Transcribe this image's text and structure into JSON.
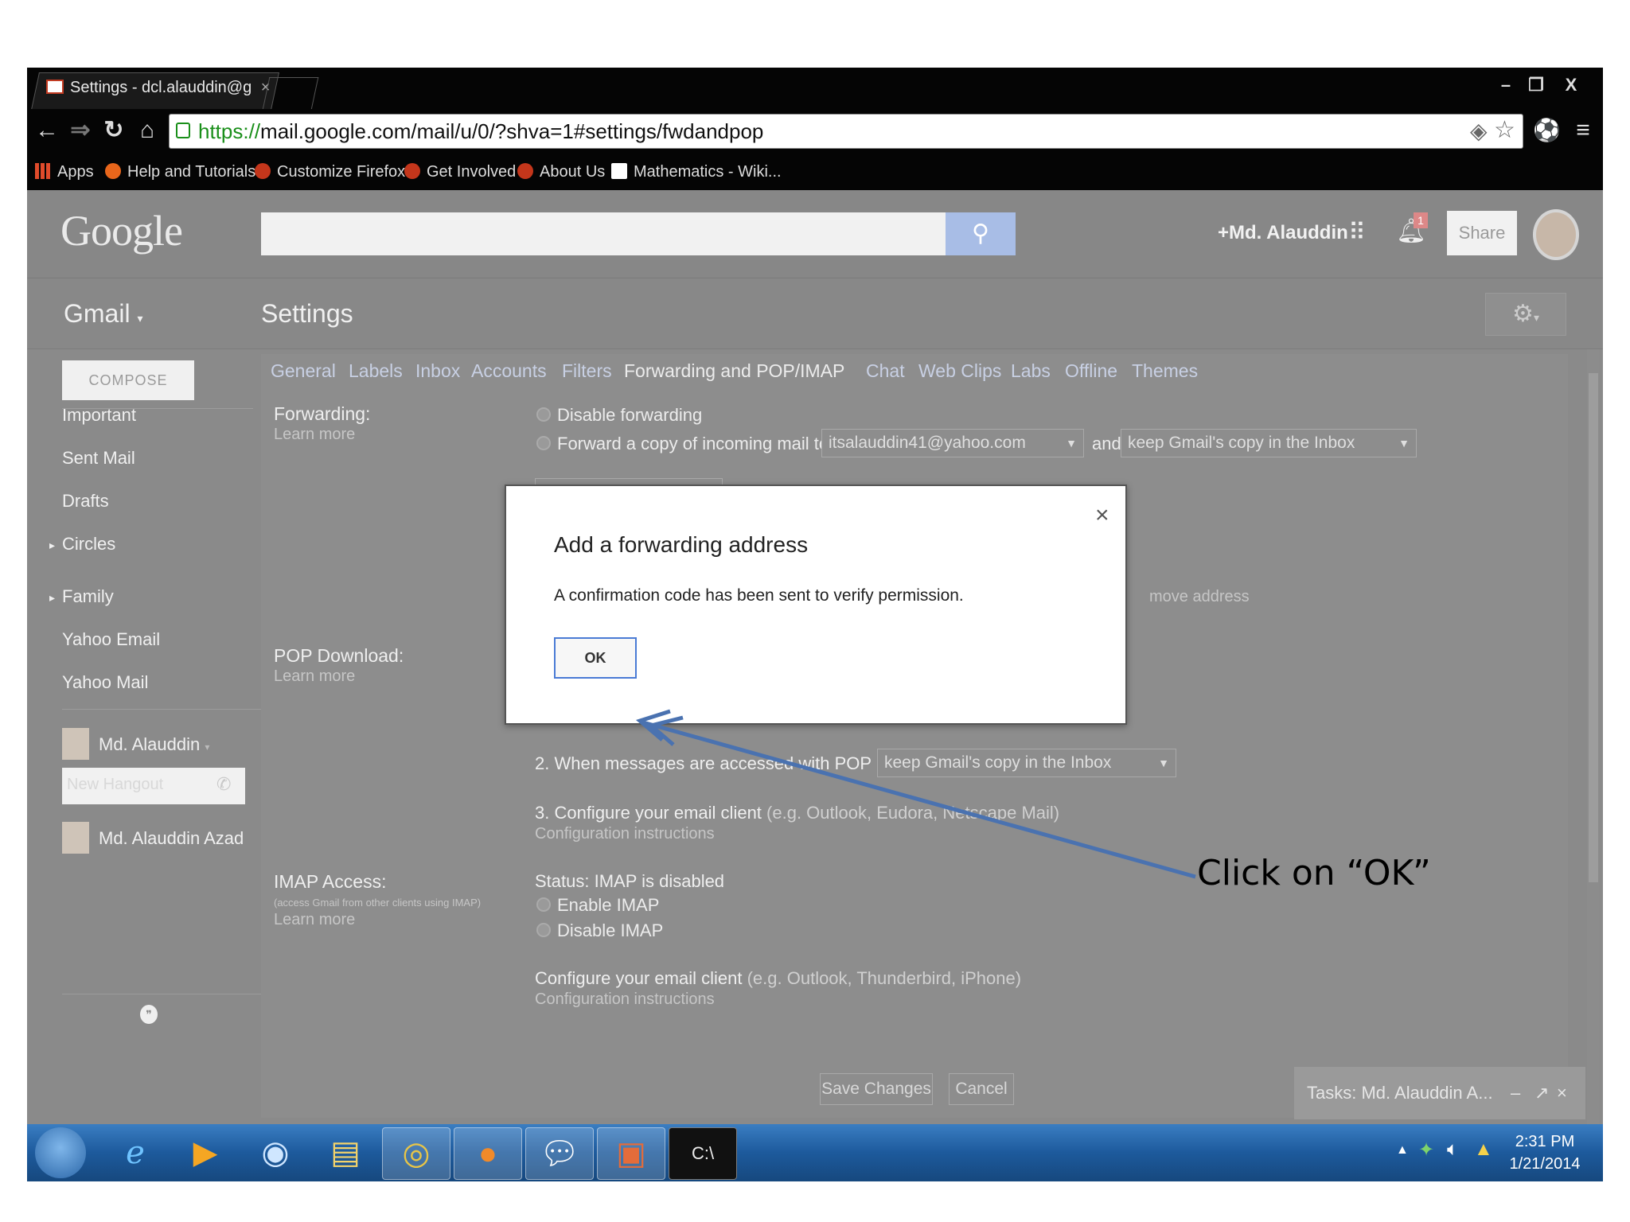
{
  "browser": {
    "tab_title": "Settings - dcl.alauddin@g",
    "url_scheme": "https://",
    "url_rest": "mail.google.com/mail/u/0/?shva=1#settings/fwdandpop",
    "bookmarks": [
      "Apps",
      "Help and Tutorials",
      "Customize Firefox",
      "Get Involved",
      "About Us",
      "Mathematics - Wiki..."
    ]
  },
  "gmail": {
    "logo": "Google",
    "user_name": "+Md. Alauddin",
    "notification_count": "1",
    "share_label": "Share",
    "app_label": "Gmail",
    "page_title": "Settings",
    "compose_label": "COMPOSE",
    "nav_items": [
      "Important",
      "Sent Mail",
      "Drafts",
      "Circles",
      "Family",
      "Yahoo Email",
      "Yahoo Mail"
    ],
    "hangout_user": "Md. Alauddin",
    "hangout_placeholder": "New Hangout",
    "hangout_contact": "Md. Alauddin Azad",
    "settings_tabs": [
      "General",
      "Labels",
      "Inbox",
      "Accounts",
      "Filters",
      "Forwarding and POP/IMAP",
      "Chat",
      "Web Clips",
      "Labs",
      "Offline",
      "Themes"
    ],
    "forwarding": {
      "label": "Forwarding:",
      "learn_more": "Learn more",
      "disable_option": "Disable forwarding",
      "forward_option": "Forward a copy of incoming mail to",
      "forward_address": "itsalauddin41@yahoo.com",
      "and_label": "and",
      "keep_option": "keep Gmail's copy in the Inbox",
      "add_button": "Add a forwarding address",
      "remove_address": "move address"
    },
    "pop": {
      "label": "POP Download:",
      "learn_more": "Learn more",
      "step2": "2. When messages are accessed with POP",
      "step2_value": "keep Gmail's copy in the Inbox",
      "step3": "3. Configure your email client",
      "step3_hint": "(e.g. Outlook, Eudora, Netscape Mail)",
      "config_link": "Configuration instructions"
    },
    "imap": {
      "label": "IMAP Access:",
      "hint": "(access Gmail from other clients using IMAP)",
      "learn_more": "Learn more",
      "status": "Status: IMAP is disabled",
      "enable": "Enable IMAP",
      "disable": "Disable IMAP",
      "configure": "Configure your email client",
      "configure_hint": "(e.g. Outlook, Thunderbird, iPhone)",
      "config_link": "Configuration instructions"
    },
    "save_button": "Save Changes",
    "cancel_button": "Cancel",
    "tasks_panel": "Tasks: Md. Alauddin A..."
  },
  "dialog": {
    "title": "Add a forwarding address",
    "message": "A confirmation code has been sent to verify permission.",
    "ok_label": "OK",
    "close_glyph": "×"
  },
  "taskbar": {
    "time": "2:31 PM",
    "date": "1/21/2014"
  },
  "annotation": {
    "text": "Click on “OK”",
    "arrow_color": "#4a72b0"
  },
  "colors": {
    "accent_blue": "#4a7bd5",
    "overlay_gray": "#8a8a8a",
    "url_green": "#1a8f1a"
  }
}
